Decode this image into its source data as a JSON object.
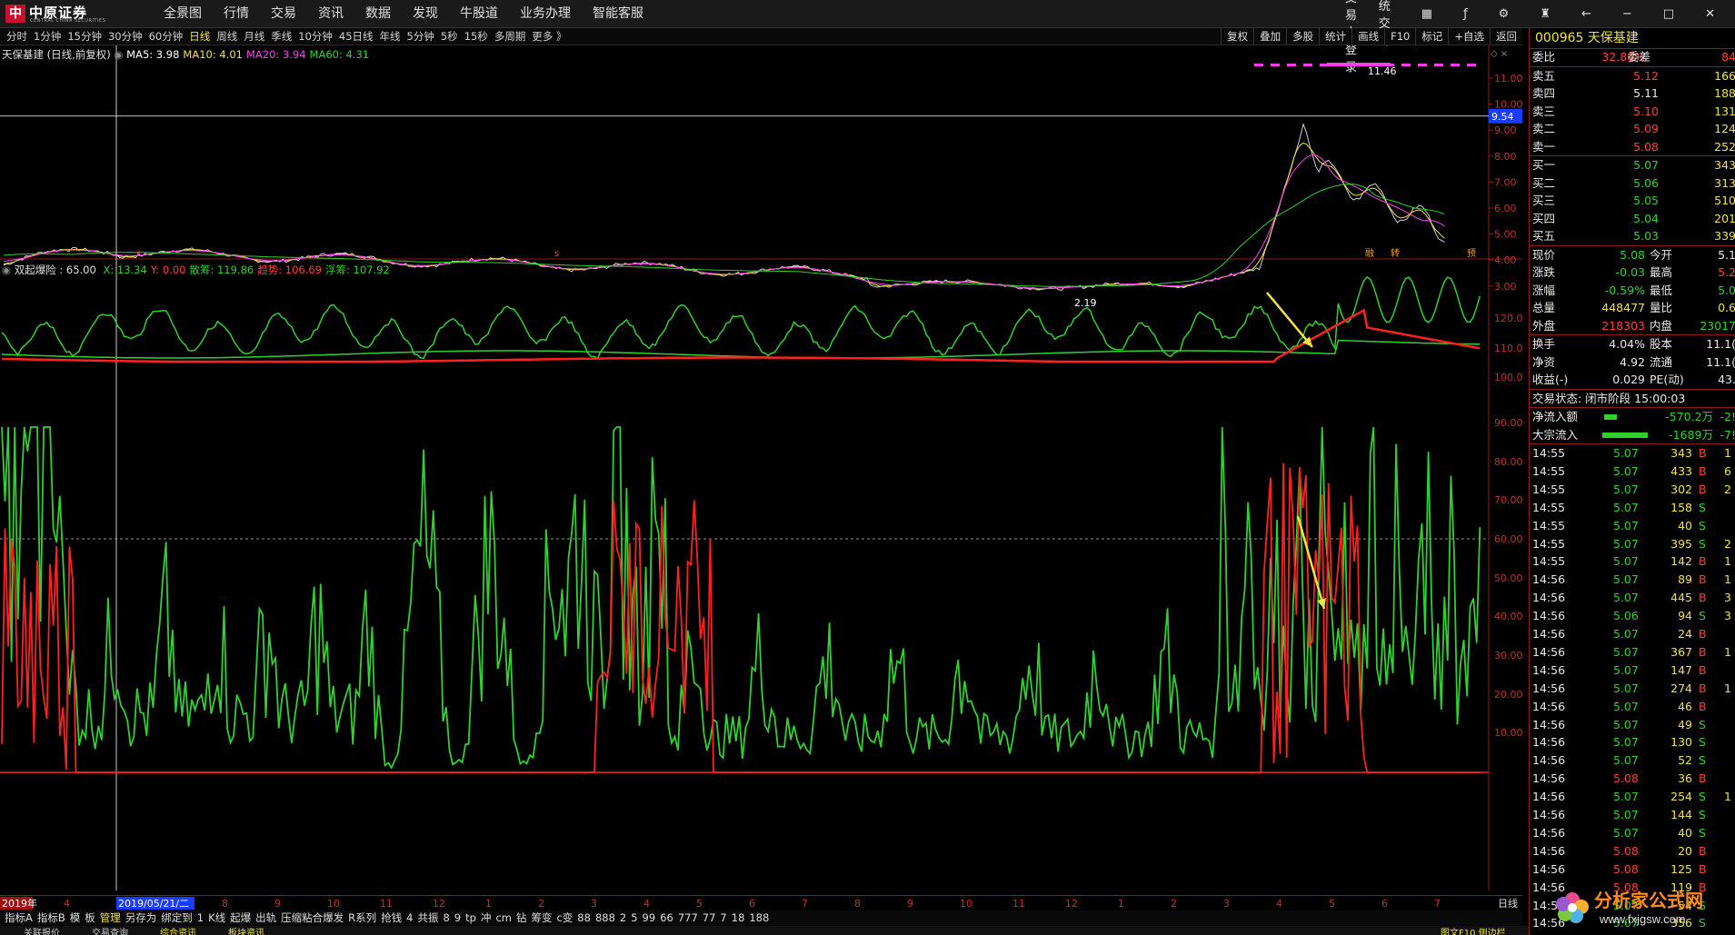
{
  "topbar": {
    "logo_name": "中原证券",
    "logo_sub": "CENTRAL CHINA SECURITIES",
    "menu": [
      "全景图",
      "行情",
      "交易",
      "资讯",
      "数据",
      "发现",
      "牛股道",
      "业务办理",
      "智能客服"
    ],
    "links": [
      "证券交易未登录",
      "传统交易"
    ]
  },
  "periodbar": {
    "periods": [
      "分时",
      "1分钟",
      "15分钟",
      "30分钟",
      "60分钟",
      "日线",
      "周线",
      "月线",
      "季线",
      "10分钟",
      "45日线",
      "年线",
      "5分钟",
      "5秒",
      "15秒",
      "多周期",
      "更多 》"
    ],
    "active": "日线",
    "tools": [
      "复权",
      "叠加",
      "多股",
      "统计",
      "画线",
      "F10",
      "标记",
      "+自选",
      "返回"
    ]
  },
  "main_chart": {
    "title": "天保基建 (日线,前复权)",
    "ma_labels": [
      {
        "text": "MA5: 3.98",
        "color": "#ffffff"
      },
      {
        "text": "MA10: 4.01",
        "color": "#f0e442"
      },
      {
        "text": "MA20: 3.94",
        "color": "#ff3cf0"
      },
      {
        "text": "MA60: 4.31",
        "color": "#2ed12e"
      }
    ],
    "y_ticks": [
      "11.00",
      "10.00",
      "9.00",
      "8.00",
      "7.00",
      "6.00",
      "5.00",
      "4.00",
      "3.00"
    ],
    "cursor_price": "9.54",
    "high_label": "11.46",
    "low_label": "2.19",
    "markers": [
      "s",
      "s",
      "融",
      "转",
      "预"
    ]
  },
  "indicator": {
    "title": "双起爆险 : 65.00",
    "values": [
      {
        "text": "X: 13.34",
        "color": "#2ed12e"
      },
      {
        "text": "Y: 0.00",
        "color": "#ff3c3c"
      },
      {
        "text": "散筹: 119.86",
        "color": "#2ed12e"
      },
      {
        "text": "趋势: 106.69",
        "color": "#ff3c3c"
      },
      {
        "text": "浮筹: 107.92",
        "color": "#2ed12e"
      }
    ],
    "upper_ticks": [
      "120.0",
      "110.0",
      "100.0"
    ],
    "lower_ticks": [
      "90.00",
      "80.00",
      "70.00",
      "60.00",
      "50.00",
      "40.00",
      "30.00",
      "20.00",
      "10.00"
    ]
  },
  "datebar": {
    "start": "2019年",
    "cursor_date": "2019/05/21/二",
    "months": [
      "4",
      "5",
      "7",
      "8",
      "9",
      "10",
      "11",
      "12",
      "1",
      "2",
      "3",
      "4",
      "5",
      "6",
      "7",
      "8",
      "9",
      "10",
      "11",
      "12",
      "1",
      "2",
      "3",
      "4",
      "5",
      "6",
      "7"
    ],
    "right_label": "日线"
  },
  "indbar": {
    "items": [
      "指标A",
      "指标B",
      "模",
      "板",
      "管理",
      "另存为",
      "绑定到",
      "1",
      "K线",
      "起爆",
      "出轨",
      "压缩粘合爆发",
      "R系列",
      "抢钱",
      "4",
      "共振",
      "8",
      "9",
      "tp",
      "冲",
      "cm",
      "钻",
      "筹变",
      "c变",
      "88",
      "888",
      "2",
      "5",
      "99",
      "66",
      "777",
      "77",
      "7",
      "18",
      "188"
    ],
    "active": "管理"
  },
  "statusbar": {
    "items": [
      "关联报价",
      "交易查询",
      "综合资讯",
      "板块资讯"
    ],
    "right": "图文F10 侧边栏"
  },
  "right_panel": {
    "code_name": "000965 天保基建",
    "weibi": {
      "label1": "委比",
      "v1": "32.86%",
      "label2": "委差",
      "v2": "84"
    },
    "sells": [
      {
        "label": "卖五",
        "price": "5.12",
        "vol": "166"
      },
      {
        "label": "卖四",
        "price": "5.11",
        "vol": "188"
      },
      {
        "label": "卖三",
        "price": "5.10",
        "vol": "131"
      },
      {
        "label": "卖二",
        "price": "5.09",
        "vol": "124"
      },
      {
        "label": "卖一",
        "price": "5.08",
        "vol": "252"
      }
    ],
    "buys": [
      {
        "label": "买一",
        "price": "5.07",
        "vol": "343"
      },
      {
        "label": "买二",
        "price": "5.06",
        "vol": "313"
      },
      {
        "label": "买三",
        "price": "5.05",
        "vol": "510"
      },
      {
        "label": "买四",
        "price": "5.04",
        "vol": "201"
      },
      {
        "label": "买五",
        "price": "5.03",
        "vol": "339"
      }
    ],
    "quote": [
      {
        "l1": "现价",
        "v1": "5.08",
        "c1": "green",
        "l2": "今开",
        "v2": "5.1",
        "c2": "white"
      },
      {
        "l1": "涨跌",
        "v1": "-0.03",
        "c1": "green",
        "l2": "最高",
        "v2": "5.2",
        "c2": "red"
      },
      {
        "l1": "涨幅",
        "v1": "-0.59%",
        "c1": "green",
        "l2": "最低",
        "v2": "5.0",
        "c2": "green"
      },
      {
        "l1": "总量",
        "v1": "448477",
        "c1": "yellow",
        "l2": "量比",
        "v2": "0.6",
        "c2": "yellow"
      },
      {
        "l1": "外盘",
        "v1": "218303",
        "c1": "red",
        "l2": "内盘",
        "v2": "23017",
        "c2": "green"
      }
    ],
    "fund": [
      {
        "l1": "换手",
        "v1": "4.04%",
        "l2": "股本",
        "v2": "11.1("
      },
      {
        "l1": "净资",
        "v1": "4.92",
        "l2": "流通",
        "v2": "11.1("
      },
      {
        "l1": "收益(-)",
        "v1": "0.029",
        "l2": "PE(动)",
        "v2": "43."
      }
    ],
    "status": "交易状态: 闭市阶段 15:00:03",
    "flows": [
      {
        "label": "净流入额",
        "value": "-570.2万",
        "extra": "-2!"
      },
      {
        "label": "大宗流入",
        "value": "-1689万",
        "extra": "-7!"
      }
    ],
    "ticks": [
      [
        "14:55",
        "5.07",
        "343",
        "B",
        "1"
      ],
      [
        "14:55",
        "5.07",
        "433",
        "B",
        "6"
      ],
      [
        "14:55",
        "5.07",
        "302",
        "B",
        "2"
      ],
      [
        "14:55",
        "5.07",
        "158",
        "S",
        ""
      ],
      [
        "14:55",
        "5.07",
        "40",
        "S",
        ""
      ],
      [
        "14:55",
        "5.07",
        "395",
        "S",
        "2"
      ],
      [
        "14:55",
        "5.07",
        "142",
        "B",
        "1"
      ],
      [
        "14:56",
        "5.07",
        "89",
        "B",
        "1"
      ],
      [
        "14:56",
        "5.07",
        "445",
        "B",
        "3"
      ],
      [
        "14:56",
        "5.06",
        "94",
        "S",
        "3"
      ],
      [
        "14:56",
        "5.07",
        "24",
        "B",
        ""
      ],
      [
        "14:56",
        "5.07",
        "367",
        "B",
        "1"
      ],
      [
        "14:56",
        "5.07",
        "147",
        "B",
        ""
      ],
      [
        "14:56",
        "5.07",
        "274",
        "B",
        "1"
      ],
      [
        "14:56",
        "5.07",
        "46",
        "B",
        ""
      ],
      [
        "14:56",
        "5.07",
        "49",
        "S",
        ""
      ],
      [
        "14:56",
        "5.07",
        "130",
        "S",
        ""
      ],
      [
        "14:56",
        "5.07",
        "52",
        "S",
        ""
      ],
      [
        "14:56",
        "5.08",
        "36",
        "B",
        ""
      ],
      [
        "14:56",
        "5.07",
        "254",
        "S",
        "1"
      ],
      [
        "14:56",
        "5.07",
        "144",
        "S",
        ""
      ],
      [
        "14:56",
        "5.07",
        "40",
        "S",
        ""
      ],
      [
        "14:56",
        "5.08",
        "20",
        "B",
        ""
      ],
      [
        "14:56",
        "5.08",
        "125",
        "B",
        ""
      ],
      [
        "14:56",
        "5.08",
        "119",
        "B",
        ""
      ],
      [
        "14:56",
        "5.07",
        "54",
        "S",
        ""
      ],
      [
        "14:56",
        "5.07",
        "356",
        "S",
        ""
      ]
    ]
  },
  "watermark": {
    "title": "分析家公式网",
    "url": "www.fxjgsw.com"
  },
  "colors": {
    "up": "#ff3c3c",
    "down": "#2ed12e",
    "accent": "#f0e442",
    "panel_border": "#8b1a1a"
  }
}
